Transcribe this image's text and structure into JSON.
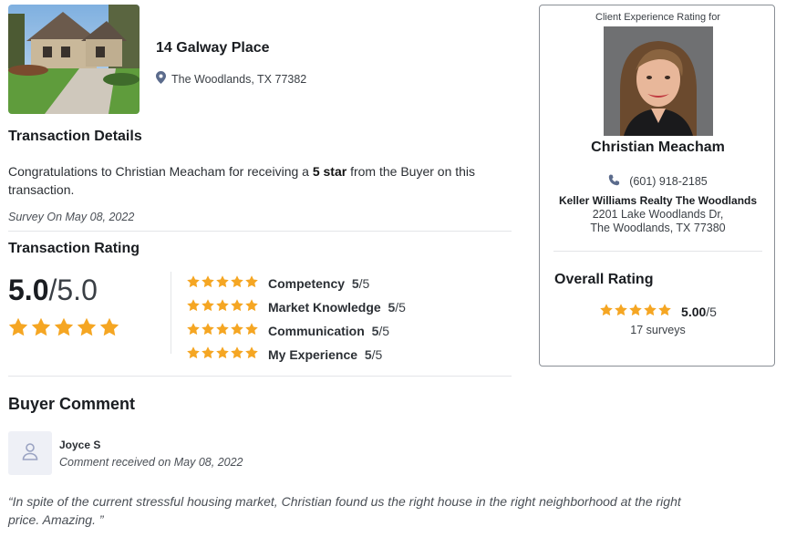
{
  "property": {
    "title": "14 Galway Place",
    "address": "The Woodlands, TX 77382",
    "icon": "map-pin-icon"
  },
  "transaction_details": {
    "heading": "Transaction Details",
    "text_prefix": "Congratulations to Christian Meacham for receiving a ",
    "text_bold": "5 star",
    "text_suffix": " from the Buyer on this transaction.",
    "survey_date": "Survey On May 08, 2022"
  },
  "transaction_rating": {
    "heading": "Transaction Rating",
    "score": "5.0",
    "out_of": "/5.0",
    "stars": 5,
    "categories": [
      {
        "name": "Competency",
        "score": "5",
        "out_of": "/5",
        "stars": 5
      },
      {
        "name": "Market Knowledge",
        "score": "5",
        "out_of": "/5",
        "stars": 5
      },
      {
        "name": "Communication",
        "score": "5",
        "out_of": "/5",
        "stars": 5
      },
      {
        "name": "My Experience",
        "score": "5",
        "out_of": "/5",
        "stars": 5
      }
    ]
  },
  "buyer_comment": {
    "heading": "Buyer Comment",
    "name": "Joyce S",
    "received": "Comment received on May 08, 2022",
    "quote": "“In spite of the current stressful housing market, Christian found us the right house in the right neighborhood at the right price. Amazing. ”",
    "avatar_icon": "user-icon"
  },
  "agent_card": {
    "header": "Client Experience Rating for",
    "name": "Christian Meacham",
    "phone": "(601) 918-2185",
    "phone_icon": "phone-icon",
    "brokerage": "Keller Williams Realty The Woodlands",
    "address_line1": "2201 Lake Woodlands Dr,",
    "address_line2": "The Woodlands, TX 77380",
    "overall_label": "Overall Rating",
    "overall_score": "5.00",
    "overall_out_of": "/5",
    "overall_stars": 5,
    "surveys": "17 surveys"
  },
  "colors": {
    "star": "#f5a623",
    "divider": "#e3e5e8",
    "icon": "#5b6b8c"
  }
}
